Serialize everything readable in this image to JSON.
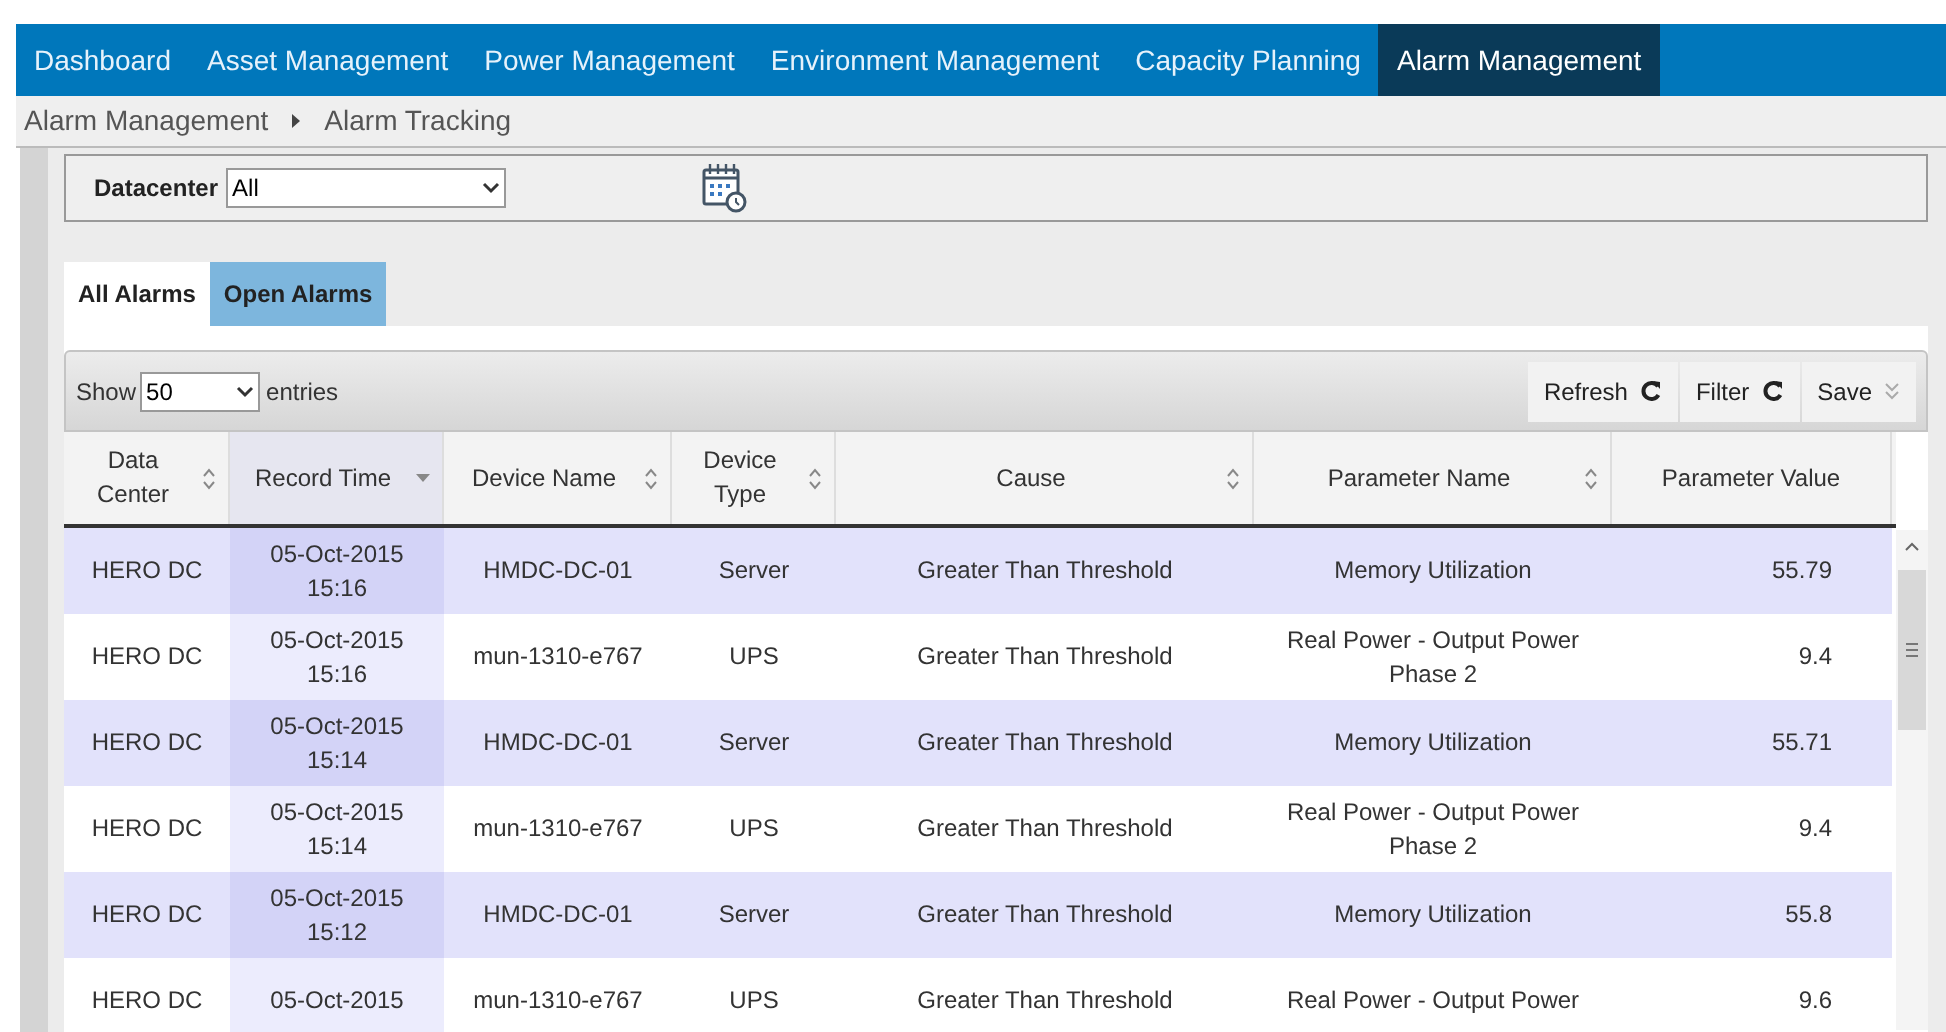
{
  "nav": [
    {
      "label": "Dashboard",
      "selected": false
    },
    {
      "label": "Asset Management",
      "selected": false
    },
    {
      "label": "Power Management",
      "selected": false
    },
    {
      "label": "Environment Management",
      "selected": false
    },
    {
      "label": "Capacity Planning",
      "selected": false
    },
    {
      "label": "Alarm Management",
      "selected": true
    }
  ],
  "breadcrumb": [
    "Alarm Management",
    "Alarm Tracking"
  ],
  "filter": {
    "label": "Datacenter",
    "value": "All"
  },
  "tabs": [
    {
      "label": "All Alarms",
      "selected": true
    },
    {
      "label": "Open Alarms",
      "selected": false
    }
  ],
  "table": {
    "show_label": "Show",
    "page_size": "50",
    "entries_label": "entries",
    "buttons": [
      {
        "label": "Refresh",
        "kind": "refresh"
      },
      {
        "label": "Filter",
        "kind": "refresh"
      },
      {
        "label": "Save",
        "kind": "menu"
      }
    ],
    "columns": [
      {
        "label": "Data Center",
        "sortable": true,
        "sorted": false
      },
      {
        "label": "Record Time",
        "sortable": true,
        "sorted": true
      },
      {
        "label": "Device Name",
        "sortable": true,
        "sorted": false
      },
      {
        "label": "Device Type",
        "sortable": true,
        "sorted": false
      },
      {
        "label": "Cause",
        "sortable": true,
        "sorted": false
      },
      {
        "label": "Parameter Name",
        "sortable": true,
        "sorted": false
      },
      {
        "label": "Parameter Value",
        "sortable": false
      }
    ],
    "rows": [
      [
        "HERO DC",
        "05-Oct-2015 15:16",
        "HMDC-DC-01",
        "Server",
        "Greater Than Threshold",
        "Memory Utilization",
        "55.79"
      ],
      [
        "HERO DC",
        "05-Oct-2015 15:16",
        "mun-1310-e767",
        "UPS",
        "Greater Than Threshold",
        "Real Power - Output Power Phase 2",
        "9.4"
      ],
      [
        "HERO DC",
        "05-Oct-2015 15:14",
        "HMDC-DC-01",
        "Server",
        "Greater Than Threshold",
        "Memory Utilization",
        "55.71"
      ],
      [
        "HERO DC",
        "05-Oct-2015 15:14",
        "mun-1310-e767",
        "UPS",
        "Greater Than Threshold",
        "Real Power - Output Power Phase 2",
        "9.4"
      ],
      [
        "HERO DC",
        "05-Oct-2015 15:12",
        "HMDC-DC-01",
        "Server",
        "Greater Than Threshold",
        "Memory Utilization",
        "55.8"
      ],
      [
        "HERO DC",
        "05-Oct-2015",
        "mun-1310-e767",
        "UPS",
        "Greater Than Threshold",
        "Real Power - Output Power",
        "9.6"
      ]
    ]
  }
}
